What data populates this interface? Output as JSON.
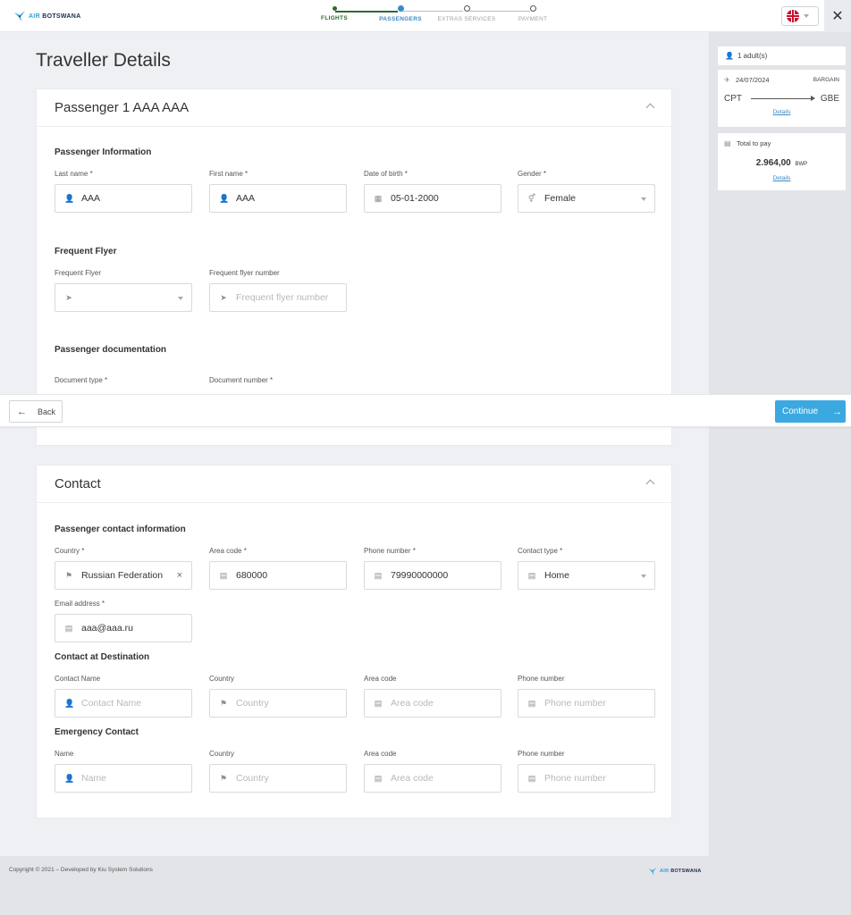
{
  "header": {
    "logo_prefix": "AIR",
    "logo_text": "BOTSWANA",
    "steps": [
      {
        "label": "FLIGHTS",
        "state": "done"
      },
      {
        "label": "PASSENGERS",
        "state": "active"
      },
      {
        "label": "EXTRAS SERVICES",
        "state": "pending"
      },
      {
        "label": "PAYMENT",
        "state": "pending"
      }
    ],
    "close_label": "✕"
  },
  "summary": {
    "passengers": "1 adult(s)",
    "flight_date": "24/07/2024",
    "fare": "BARGAIN",
    "origin": "CPT",
    "destination": "GBE",
    "flight_details_link": "Details",
    "total_label": "Total to pay",
    "total_amount": "2.964,00",
    "total_currency": "BWP",
    "total_details_link": "Details"
  },
  "page_title": "Traveller Details",
  "passenger_card": {
    "title": "Passenger 1 AAA AAA",
    "info_section": "Passenger Information",
    "last_name_label": "Last name *",
    "last_name_value": "AAA",
    "first_name_label": "First name *",
    "first_name_value": "AAA",
    "dob_label": "Date of birth *",
    "dob_value": "05-01-2000",
    "gender_label": "Gender *",
    "gender_value": "Female",
    "ff_section": "Frequent Flyer",
    "ff_label": "Frequent Flyer",
    "ff_number_label": "Frequent flyer number",
    "ff_number_placeholder": "Frequent flyer number",
    "doc_section": "Passenger documentation",
    "doc_type_label": "Document type *",
    "doc_number_label": "Document number *"
  },
  "actions": {
    "back_label": "Back",
    "continue_label": "Continue"
  },
  "contact_card": {
    "title": "Contact",
    "pci_section": "Passenger contact information",
    "country_label": "Country *",
    "country_value": "Russian Federation",
    "area_code_label": "Area code *",
    "area_code_value": "680000",
    "phone_label": "Phone number *",
    "phone_value": "79990000000",
    "contact_type_label": "Contact type *",
    "contact_type_value": "Home",
    "email_label": "Email address *",
    "email_value": "aaa@aaa.ru",
    "dest_section": "Contact at Destination",
    "dest_name_label": "Contact Name",
    "dest_name_placeholder": "Contact Name",
    "dest_country_label": "Country",
    "dest_country_placeholder": "Country",
    "dest_area_label": "Area code",
    "dest_area_placeholder": "Area code",
    "dest_phone_label": "Phone number",
    "dest_phone_placeholder": "Phone number",
    "emg_section": "Emergency Contact",
    "emg_name_label": "Name",
    "emg_name_placeholder": "Name",
    "emg_country_label": "Country",
    "emg_country_placeholder": "Country",
    "emg_area_label": "Area code",
    "emg_area_placeholder": "Area code",
    "emg_phone_label": "Phone number",
    "emg_phone_placeholder": "Phone number"
  },
  "footer": {
    "copyright": "Copyright © 2021 – Developed by Kiu System Solutions"
  },
  "colors": {
    "accent": "#3ba9e0",
    "step_done": "#2b6a2f",
    "step_active": "#3b8bc4"
  }
}
